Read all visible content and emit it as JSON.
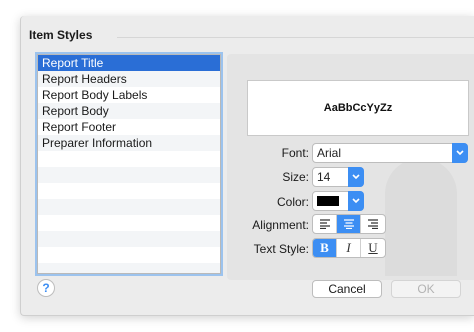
{
  "group_title": "Item Styles",
  "items": [
    "Report Title",
    "Report Headers",
    "Report Body Labels",
    "Report Body",
    "Report Footer",
    "Preparer Information"
  ],
  "selected_index": 0,
  "preview_text": "AaBbCcYyZz",
  "form": {
    "font_label": "Font:",
    "font_value": "Arial",
    "size_label": "Size:",
    "size_value": "14",
    "color_label": "Color:",
    "color_value": "#000000",
    "alignment_label": "Alignment:",
    "alignment_selected": "center",
    "text_style_label": "Text Style:",
    "bold_label": "B",
    "italic_label": "I",
    "underline_label": "U",
    "bold_active": true
  },
  "buttons": {
    "help": "?",
    "cancel": "Cancel",
    "ok": "OK"
  },
  "colors": {
    "accent": "#3c8ef3",
    "selection": "#2a6ed6",
    "focus_ring": "#9cc3ee"
  }
}
